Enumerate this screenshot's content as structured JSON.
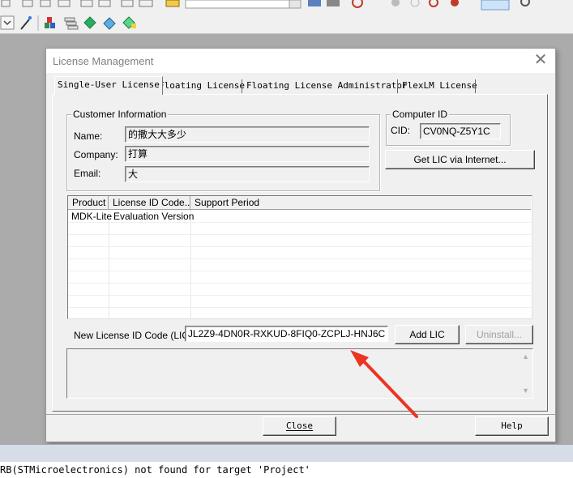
{
  "dialog": {
    "title": "License Management",
    "close_glyph": "✕",
    "tabs": [
      {
        "label": "Single-User License",
        "selected": true
      },
      {
        "label": "Floating License",
        "selected": false
      },
      {
        "label": "Floating License Administrator",
        "selected": false
      },
      {
        "label": "FlexLM License",
        "selected": false
      }
    ],
    "customer_info": {
      "legend": "Customer Information",
      "name_label": "Name:",
      "name_value": "的撒大大多少",
      "company_label": "Company:",
      "company_value": "打算",
      "email_label": "Email:",
      "email_value": "大"
    },
    "computer_id": {
      "legend": "Computer ID",
      "cid_label": "CID:",
      "cid_value": "CV0NQ-Z5Y1C",
      "get_lic_button": "Get LIC via Internet..."
    },
    "license_table": {
      "columns": [
        "Product",
        "License ID Code...",
        "Support Period"
      ],
      "rows": [
        [
          "MDK-Lite",
          "Evaluation Version",
          ""
        ]
      ]
    },
    "new_lic": {
      "label": "New License ID Code (LIC):",
      "value": "JL2Z9-4DN0R-RXKUD-8FIQ0-ZCPLJ-HNJ6C",
      "add_button": "Add LIC",
      "uninstall_button": "Uninstall..."
    },
    "close_button": "Close",
    "help_button": "Help"
  },
  "output": {
    "text": "RB(STMicroelectronics) not found for target 'Project'"
  },
  "colors": {
    "annotation_arrow": "#ee3322",
    "desktop_bg": "#ababab",
    "dialog_bg": "#f0f0f0"
  }
}
